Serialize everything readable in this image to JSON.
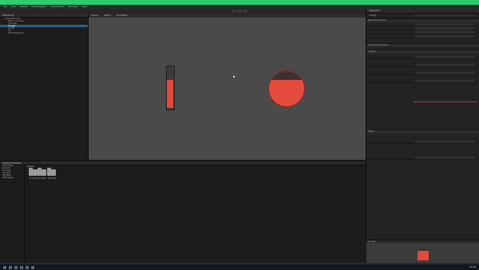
{
  "menu": [
    "File",
    "Edit",
    "Assets",
    "GameObject",
    "Component",
    "Window",
    "Help"
  ],
  "toolbar": {
    "account": "Account",
    "layers": "Layers",
    "layout": "Layout"
  },
  "hierarchy": {
    "tab": "Hierarchy",
    "rows": [
      "SampleScene",
      "Main Camera",
      "Canvas",
      "Image",
      "Slider",
      "Fill",
      "EventSystem"
    ]
  },
  "scene": {
    "tabs": [
      "Scene",
      "Game",
      "Animator"
    ]
  },
  "project": {
    "tabs": [
      "Project",
      "Console"
    ],
    "tree": [
      "Favorites",
      "Assets",
      "Scenes",
      "Scripts",
      "Sprites",
      "Packages"
    ],
    "breadcrumb": "Assets",
    "folders": [
      "Scenes",
      "Scripts",
      "Sprites"
    ]
  },
  "inspector": {
    "tab": "Inspector",
    "object_name": "Image",
    "sections": [
      "Rect Transform",
      "Canvas Renderer",
      "Image",
      "Mask"
    ]
  },
  "preview": {
    "title": "Image"
  },
  "taskbar": {
    "time": "12:00"
  },
  "colors": {
    "accent_red": "#e14a3c",
    "topbar_green": "#2ecc71"
  }
}
